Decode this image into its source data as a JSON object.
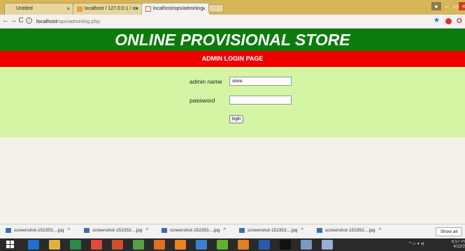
{
  "browser": {
    "tabs": [
      {
        "label": "Untitled",
        "icon": "page-icon"
      },
      {
        "label": "localhost / 127.0.0.1 / on",
        "icon": "phpmyadmin-icon"
      },
      {
        "label": "localhost/ops/adminlog",
        "icon": "page-icon"
      }
    ],
    "address": {
      "host": "localhost",
      "path": "/ops/adminlog.php"
    },
    "nav": {
      "back": "←",
      "forward": "→",
      "reload": "C"
    }
  },
  "page": {
    "title": "ONLINE PROVISIONAL STORE",
    "subtitle": "ADMIN LOGIN PAGE",
    "form": {
      "admin_name_label": "admin name",
      "admin_name_value": "store",
      "password_label": "password",
      "password_value": "",
      "login_label": "login"
    }
  },
  "downloads": {
    "items": [
      {
        "name": "screenshot-152353....jpg"
      },
      {
        "name": "screenshot-152353....jpg"
      },
      {
        "name": "screenshot-152353....jpg"
      },
      {
        "name": "screenshot-152353....jpg"
      },
      {
        "name": "screenshot-152353....jpg"
      }
    ],
    "show_all": "Show all",
    "caret": "^"
  },
  "taskbar": {
    "clock_time": "6:57 PI",
    "clock_date": "4/12/2"
  },
  "colors": {
    "header_green": "#0b7c0b",
    "header_red": "#ee0000",
    "form_bg": "#d3f5a4",
    "page_bg": "#f5f0e8"
  }
}
